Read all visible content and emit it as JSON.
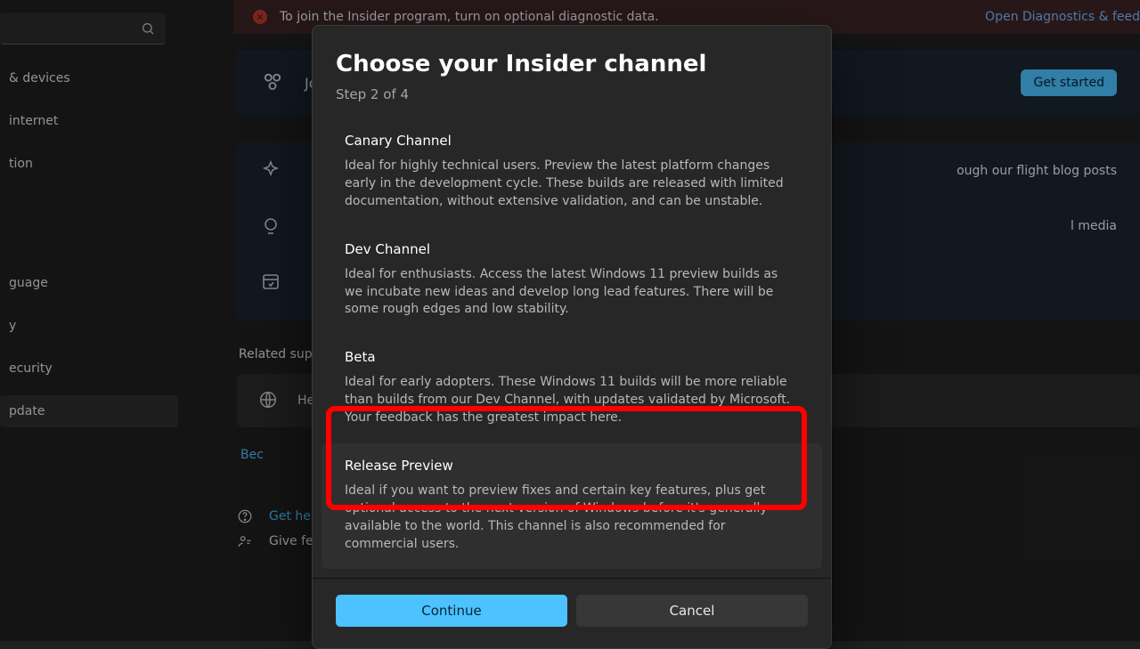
{
  "sidebar": {
    "items": [
      "& devices",
      "internet",
      "tion",
      "guage",
      "y",
      "ecurity",
      "pdate"
    ],
    "selected_index": 6
  },
  "banner": {
    "message": "To join the Insider program, turn on optional diagnostic data.",
    "link": "Open Diagnostics & feed"
  },
  "join_card": {
    "label": "Join",
    "cta": "Get started"
  },
  "background_text": {
    "right_1": "ough our flight blog posts",
    "right_2": "l media",
    "help_label": "Hel",
    "below_help_link": "Bec"
  },
  "section_title": "Related supp",
  "links": {
    "get_help": "Get help",
    "give_feedback": "Give fee"
  },
  "modal": {
    "title": "Choose your Insider channel",
    "step": "Step 2 of 4",
    "selected_index": 3,
    "channels": [
      {
        "title": "Canary Channel",
        "desc": "Ideal for highly technical users. Preview the latest platform changes early in the development cycle. These builds are released with limited documentation, without extensive validation, and can be unstable."
      },
      {
        "title": "Dev Channel",
        "desc": "Ideal for enthusiasts. Access the latest Windows 11 preview builds as we incubate new ideas and develop long lead features. There will be some rough edges and low stability."
      },
      {
        "title": "Beta",
        "desc": "Ideal for early adopters. These Windows 11 builds will be more reliable than builds from our Dev Channel, with updates validated by Microsoft. Your feedback has the greatest impact here."
      },
      {
        "title": "Release Preview",
        "desc": "Ideal if you want to preview fixes and certain key features, plus get optional access to the next version of Windows before it's generally available to the world. This channel is also recommended for commercial users."
      }
    ],
    "continue": "Continue",
    "cancel": "Cancel"
  }
}
